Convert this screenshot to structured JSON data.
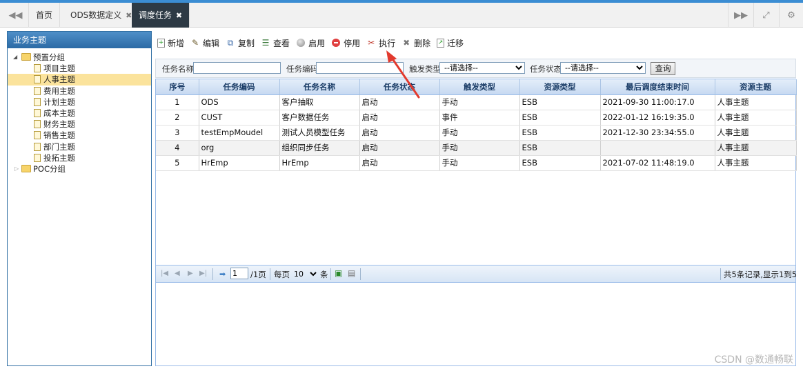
{
  "tabbar": {
    "tabs": [
      {
        "label": "首页"
      },
      {
        "label": "ODS数据定义",
        "close": "✖"
      },
      {
        "label": "调度任务",
        "close": "✖"
      }
    ],
    "icons": {
      "prev": "double-left-arrow",
      "next": "double-right-arrow",
      "fullscreen": "expand",
      "settings": "gear"
    }
  },
  "leftpanel": {
    "title": "业务主题",
    "groups": [
      {
        "label": "预置分组",
        "expanded": true,
        "items": [
          "项目主题",
          "人事主题",
          "费用主题",
          "计划主题",
          "成本主题",
          "财务主题",
          "销售主题",
          "部门主题",
          "投拓主题"
        ],
        "selected": "人事主题"
      },
      {
        "label": "POC分组",
        "expanded": false
      }
    ]
  },
  "toolbar": {
    "buttons": [
      {
        "label": "新增",
        "icon": "add-doc"
      },
      {
        "label": "编辑",
        "icon": "pencil"
      },
      {
        "label": "复制",
        "icon": "copy"
      },
      {
        "label": "查看",
        "icon": "view-list"
      },
      {
        "label": "启用",
        "icon": "enable-circle"
      },
      {
        "label": "停用",
        "icon": "disable-circle"
      },
      {
        "label": "执行",
        "icon": "run-tools"
      },
      {
        "label": "删除",
        "icon": "delete-x"
      },
      {
        "label": "迁移",
        "icon": "migrate"
      }
    ]
  },
  "search": {
    "task_name_label": "任务名称",
    "task_name_value": "",
    "task_code_label": "任务编码",
    "task_code_value": "",
    "trigger_label": "触发类型",
    "trigger_value": "--请选择--",
    "status_label": "任务状态",
    "status_value": "--请选择--",
    "query_label": "查询"
  },
  "grid": {
    "columns": [
      "序号",
      "任务编码",
      "任务名称",
      "任务状态",
      "触发类型",
      "资源类型",
      "最后调度结束时间",
      "资源主题"
    ],
    "rows": [
      [
        "1",
        "ODS",
        "客户抽取",
        "启动",
        "手动",
        "ESB",
        "2021-09-30 11:00:17.0",
        "人事主题"
      ],
      [
        "2",
        "CUST",
        "客户数据任务",
        "启动",
        "事件",
        "ESB",
        "2022-01-12 16:19:35.0",
        "人事主题"
      ],
      [
        "3",
        "testEmpMoudel",
        "测试人员模型任务",
        "启动",
        "手动",
        "ESB",
        "2021-12-30 23:34:55.0",
        "人事主题"
      ],
      [
        "4",
        "org",
        "组织同步任务",
        "启动",
        "手动",
        "ESB",
        "",
        "人事主题"
      ],
      [
        "5",
        "HrEmp",
        "HrEmp",
        "启动",
        "手动",
        "ESB",
        "2021-07-02 11:48:19.0",
        "人事主题"
      ]
    ]
  },
  "pager": {
    "page": "1",
    "total_pages": "/1页",
    "per_page_label": "每页",
    "per_page_value": "10",
    "per_page_unit": "条",
    "summary": "共5条记录,显示1到5"
  },
  "watermark": "CSDN @数通畅联",
  "colors": {
    "accent": "#3b8dd3",
    "active_tab": "#2d3a45",
    "selected_node": "#fbe39c",
    "arrow": "#e23a2e"
  }
}
